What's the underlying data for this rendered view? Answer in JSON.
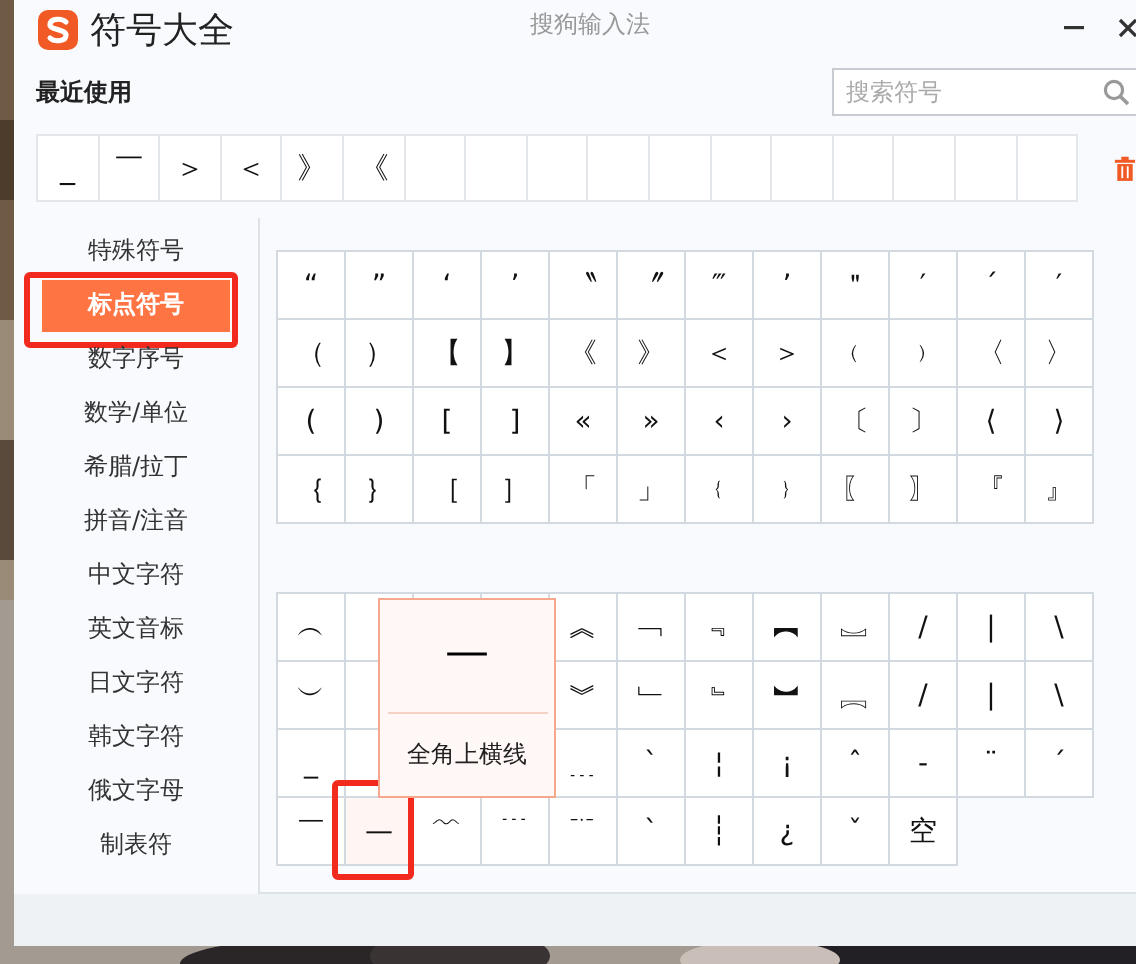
{
  "window": {
    "title": "符号大全",
    "app_name": "搜狗输入法"
  },
  "recent": {
    "label": "最近使用",
    "symbols": [
      "_",
      "￣",
      "＞",
      "＜",
      "》",
      "《"
    ]
  },
  "search": {
    "placeholder": "搜索符号"
  },
  "sidebar": {
    "items": [
      {
        "label": "特殊符号",
        "selected": false
      },
      {
        "label": "标点符号",
        "selected": true
      },
      {
        "label": "数字序号",
        "selected": false
      },
      {
        "label": "数学/单位",
        "selected": false
      },
      {
        "label": "希腊/拉丁",
        "selected": false
      },
      {
        "label": "拼音/注音",
        "selected": false
      },
      {
        "label": "中文字符",
        "selected": false
      },
      {
        "label": "英文音标",
        "selected": false
      },
      {
        "label": "日文字符",
        "selected": false
      },
      {
        "label": "韩文字符",
        "selected": false
      },
      {
        "label": "俄文字母",
        "selected": false
      },
      {
        "label": "制表符",
        "selected": false
      }
    ]
  },
  "symbol_grids": [
    {
      "rows": [
        [
          {
            "symbol": "“",
            "hovered": false
          },
          {
            "symbol": "”",
            "hovered": false
          },
          {
            "symbol": "‘",
            "hovered": false
          },
          {
            "symbol": "’",
            "hovered": false
          },
          {
            "symbol": "〝",
            "hovered": false
          },
          {
            "symbol": "〞",
            "hovered": false
          },
          {
            "symbol": "‴",
            "hovered": false
          },
          {
            "symbol": "’",
            "hovered": false
          },
          {
            "symbol": "＂",
            "hovered": false
          },
          {
            "symbol": "′",
            "hovered": false
          },
          {
            "symbol": "ˊ",
            "hovered": false
          },
          {
            "symbol": "′",
            "hovered": false
          }
        ],
        [
          {
            "symbol": "（",
            "hovered": false
          },
          {
            "symbol": "）",
            "hovered": false
          },
          {
            "symbol": "【",
            "hovered": false
          },
          {
            "symbol": "】",
            "hovered": false
          },
          {
            "symbol": "《",
            "hovered": false
          },
          {
            "symbol": "》",
            "hovered": false
          },
          {
            "symbol": "＜",
            "hovered": false
          },
          {
            "symbol": "＞",
            "hovered": false
          },
          {
            "symbol": "﹙",
            "hovered": false
          },
          {
            "symbol": "﹚",
            "hovered": false
          },
          {
            "symbol": "〈",
            "hovered": false
          },
          {
            "symbol": "〉",
            "hovered": false
          }
        ],
        [
          {
            "symbol": "(",
            "hovered": false
          },
          {
            "symbol": ")",
            "hovered": false
          },
          {
            "symbol": "[",
            "hovered": false
          },
          {
            "symbol": "]",
            "hovered": false
          },
          {
            "symbol": "«",
            "hovered": false
          },
          {
            "symbol": "»",
            "hovered": false
          },
          {
            "symbol": "‹",
            "hovered": false
          },
          {
            "symbol": "›",
            "hovered": false
          },
          {
            "symbol": "〔",
            "hovered": false
          },
          {
            "symbol": "〕",
            "hovered": false
          },
          {
            "symbol": "⟨",
            "hovered": false
          },
          {
            "symbol": "⟩",
            "hovered": false
          }
        ],
        [
          {
            "symbol": "｛",
            "hovered": false
          },
          {
            "symbol": "｝",
            "hovered": false
          },
          {
            "symbol": "［",
            "hovered": false
          },
          {
            "symbol": "］",
            "hovered": false
          },
          {
            "symbol": "「",
            "hovered": false
          },
          {
            "symbol": "」",
            "hovered": false
          },
          {
            "symbol": "﹛",
            "hovered": false
          },
          {
            "symbol": "﹜",
            "hovered": false
          },
          {
            "symbol": "〖",
            "hovered": false
          },
          {
            "symbol": "〗",
            "hovered": false
          },
          {
            "symbol": "『",
            "hovered": false
          },
          {
            "symbol": "』",
            "hovered": false
          }
        ]
      ]
    },
    {
      "rows": [
        [
          {
            "symbol": "︵",
            "hovered": false
          },
          {},
          {},
          {},
          {
            "symbol": "︽",
            "hovered": false
          },
          {
            "symbol": "﹁",
            "hovered": false
          },
          {
            "symbol": "﹃",
            "hovered": false
          },
          {
            "symbol": "︻",
            "hovered": false
          },
          {
            "symbol": "︗",
            "hovered": false
          },
          {
            "symbol": "/",
            "hovered": false
          },
          {
            "symbol": "|",
            "hovered": false
          },
          {
            "symbol": "\\",
            "hovered": false
          }
        ],
        [
          {
            "symbol": "︶",
            "hovered": false
          },
          {},
          {},
          {},
          {
            "symbol": "︾",
            "hovered": false
          },
          {
            "symbol": "﹂",
            "hovered": false
          },
          {
            "symbol": "﹄",
            "hovered": false
          },
          {
            "symbol": "︼",
            "hovered": false
          },
          {
            "symbol": "︘",
            "hovered": false
          },
          {
            "symbol": "/",
            "hovered": false
          },
          {
            "symbol": "|",
            "hovered": false
          },
          {
            "symbol": "\\",
            "hovered": false
          }
        ],
        [
          {
            "symbol": "_",
            "hovered": false
          },
          {},
          {},
          {},
          {
            "symbol": "﹍",
            "hovered": false
          },
          {
            "symbol": "ˋ",
            "hovered": false
          },
          {
            "symbol": "¦",
            "hovered": false
          },
          {
            "symbol": "¡",
            "hovered": false
          },
          {
            "symbol": "ˆ",
            "hovered": false
          },
          {
            "symbol": "-",
            "hovered": false
          },
          {
            "symbol": "¨",
            "hovered": false
          },
          {
            "symbol": "ˊ",
            "hovered": false
          }
        ],
        [
          {
            "symbol": "￣",
            "hovered": false
          },
          {
            "symbol": "—",
            "hovered": true
          },
          {
            "symbol": "﹌",
            "hovered": false
          },
          {
            "symbol": "﹉",
            "hovered": false
          },
          {
            "symbol": "﹊",
            "hovered": false
          },
          {
            "symbol": "ˋ",
            "hovered": false
          },
          {
            "symbol": "┆",
            "hovered": false
          },
          {
            "symbol": "¿",
            "hovered": false
          },
          {
            "symbol": "ˇ",
            "hovered": false
          },
          {
            "symbol": "空",
            "hovered": false
          }
        ]
      ],
      "tooltip": {
        "symbol": "—",
        "label": "全角上横线"
      }
    }
  ]
}
